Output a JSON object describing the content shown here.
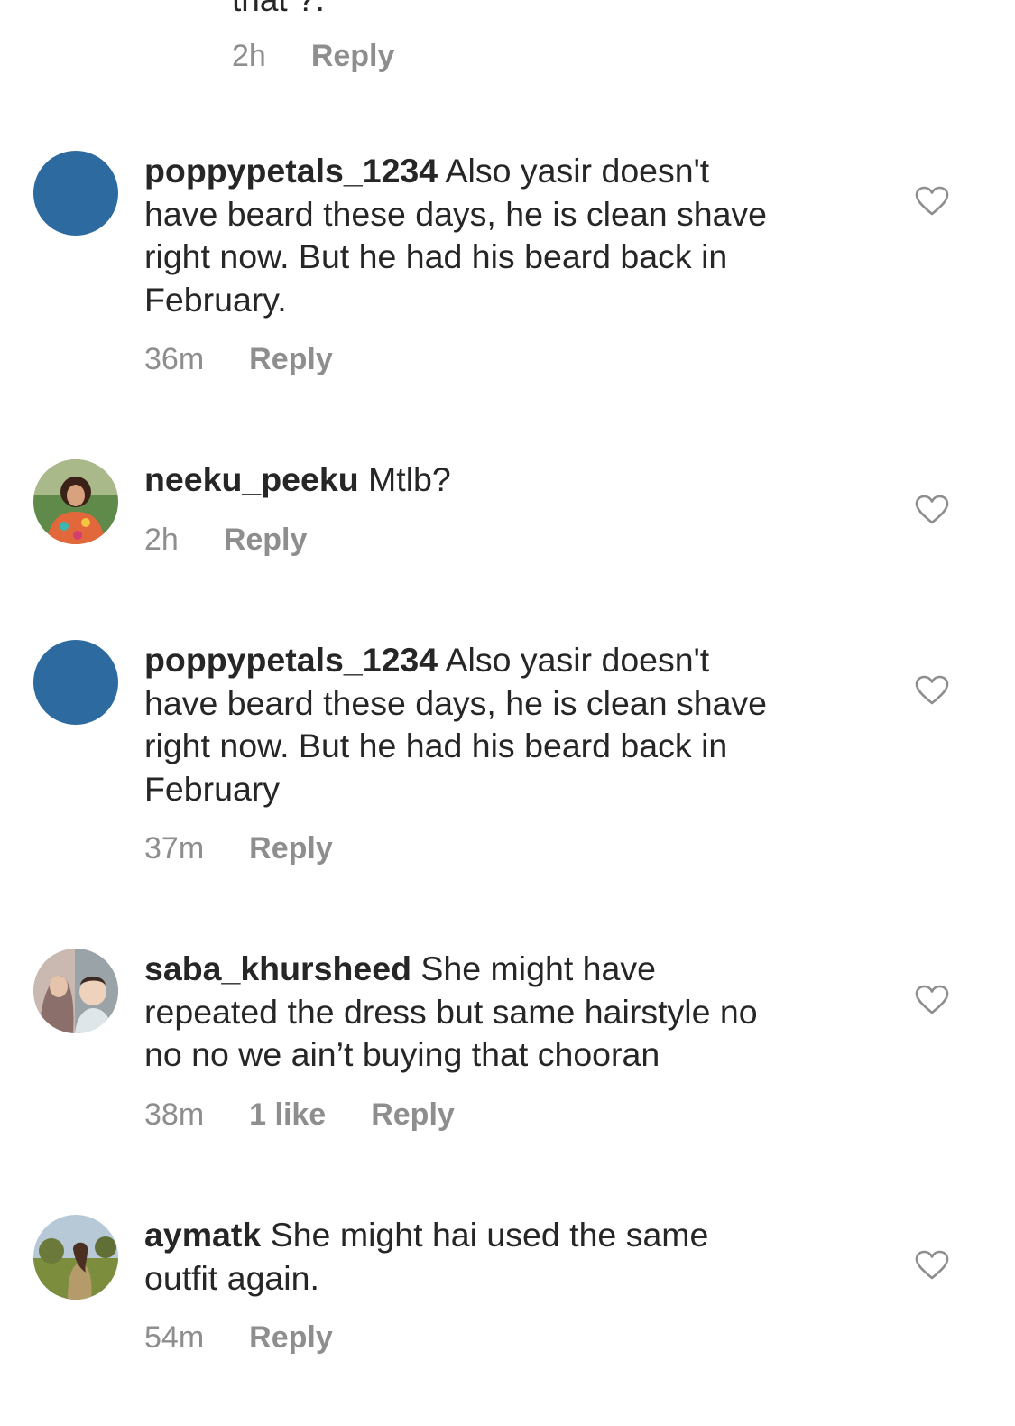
{
  "top_comment": {
    "partial_text": "that ?.",
    "time": "2h",
    "reply_label": "Reply"
  },
  "comments": [
    {
      "username": "poppypetals_1234",
      "text": "Also yasir doesn't\nhave beard these days, he is clean shave\nright now. But he had his beard back in\nFebruary.",
      "time": "36m",
      "likes": "",
      "reply_label": "Reply",
      "avatar": "blank-avatar"
    },
    {
      "username": "neeku_peeku",
      "text": "Mtlb?",
      "time": "2h",
      "likes": "",
      "reply_label": "Reply",
      "avatar": "photo-avatar"
    },
    {
      "username": "poppypetals_1234",
      "text": "Also yasir doesn't\nhave beard these days, he is clean shave\nright now.  But he had his beard back in\nFebruary",
      "time": "37m",
      "likes": "",
      "reply_label": "Reply",
      "avatar": "blank-avatar"
    },
    {
      "username": "saba_khursheed",
      "text": "She might have\nrepeated the dress but same hairstyle no\nno no we ain’t buying that chooran",
      "time": "38m",
      "likes": "1 like",
      "reply_label": "Reply",
      "avatar": "photo-avatar"
    },
    {
      "username": "aymatk",
      "text": "She might hai used the same\noutfit again.",
      "time": "54m",
      "likes": "",
      "reply_label": "Reply",
      "avatar": "photo-avatar"
    }
  ],
  "icons": {
    "like": "heart-outline-icon"
  },
  "colors": {
    "text": "#262626",
    "secondary": "#8e8e8e",
    "blank_avatar": "#2d6a9f",
    "heart_stroke": "#8e8e8e"
  }
}
